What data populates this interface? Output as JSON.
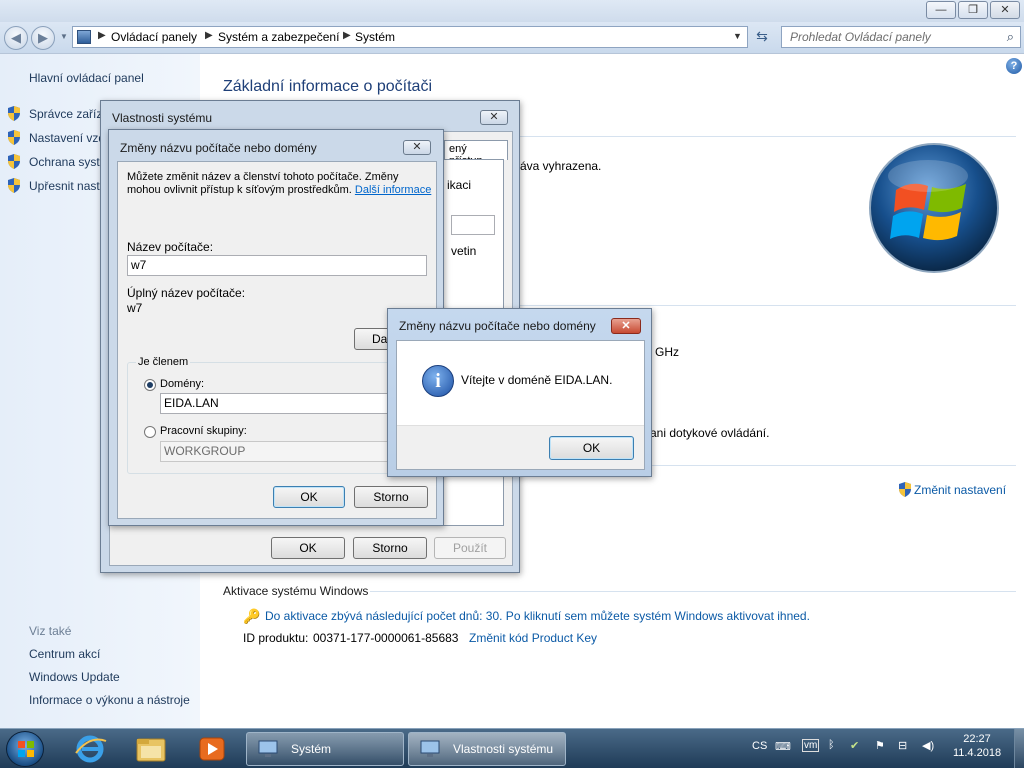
{
  "explorer": {
    "caption_buttons": {
      "minimize": "—",
      "maximize": "❐",
      "close": "✕"
    },
    "breadcrumb": [
      "Ovládací panely",
      "Systém a zabezpečení",
      "Systém"
    ],
    "search_placeholder": "Prohledat Ovládací panely",
    "help": "?",
    "sidebar": {
      "home": "Hlavní ovládací panel",
      "tasks": [
        "Správce zaříz",
        "Nastavení vzd",
        "Ochrana syste",
        "Upřesnit nast"
      ],
      "see_also_title": "Viz také",
      "see_also": [
        "Centrum akcí",
        "Windows Update",
        "Informace o výkonu a nástroje"
      ]
    },
    "main": {
      "heading": "Základní informace o počítači",
      "rights_fragment": "áva vyhrazena.",
      "ghz_fragment": "GHz",
      "touch_fragment": "ani dotykové ovládání.",
      "change_settings": "Změnit nastavení",
      "activation_title": "Aktivace systému Windows",
      "activation_text": "Do aktivace zbývá následující počet dnů: 30. Po kliknutí sem můžete systém Windows aktivovat ihned.",
      "product_id_label": "ID produktu:",
      "product_id": "00371-177-0000061-85683",
      "change_key": "Změnit kód Product Key"
    }
  },
  "sysprops": {
    "title": "Vlastnosti systému",
    "tab_fragment": "ený přístup",
    "frag_kaci": "ikaci",
    "frag_vetin": "vetin",
    "ok": "OK",
    "cancel": "Storno",
    "apply": "Použít"
  },
  "rename": {
    "title": "Změny názvu počítače nebo domény",
    "intro": "Můžete změnit název a členství tohoto počítače. Změny mohou ovlivnit přístup k síťovým prostředkům.",
    "more_info": "Další informace",
    "computer_name_label": "Název počítače:",
    "computer_name": "w7",
    "full_name_label": "Úplný název počítače:",
    "full_name": "w7",
    "more_button": "Dal",
    "member_of": "Je členem",
    "domain_label": "Domény:",
    "domain_value": "EIDA.LAN",
    "workgroup_label": "Pracovní skupiny:",
    "workgroup_value": "WORKGROUP",
    "ok": "OK",
    "cancel": "Storno"
  },
  "msgbox": {
    "title": "Změny názvu počítače nebo domény",
    "message": "Vítejte v doméně EIDA.LAN.",
    "ok": "OK"
  },
  "taskbar": {
    "apps": [
      "Systém",
      "Vlastnosti systému"
    ],
    "lang": "CS",
    "time": "22:27",
    "date": "11.4.2018"
  }
}
